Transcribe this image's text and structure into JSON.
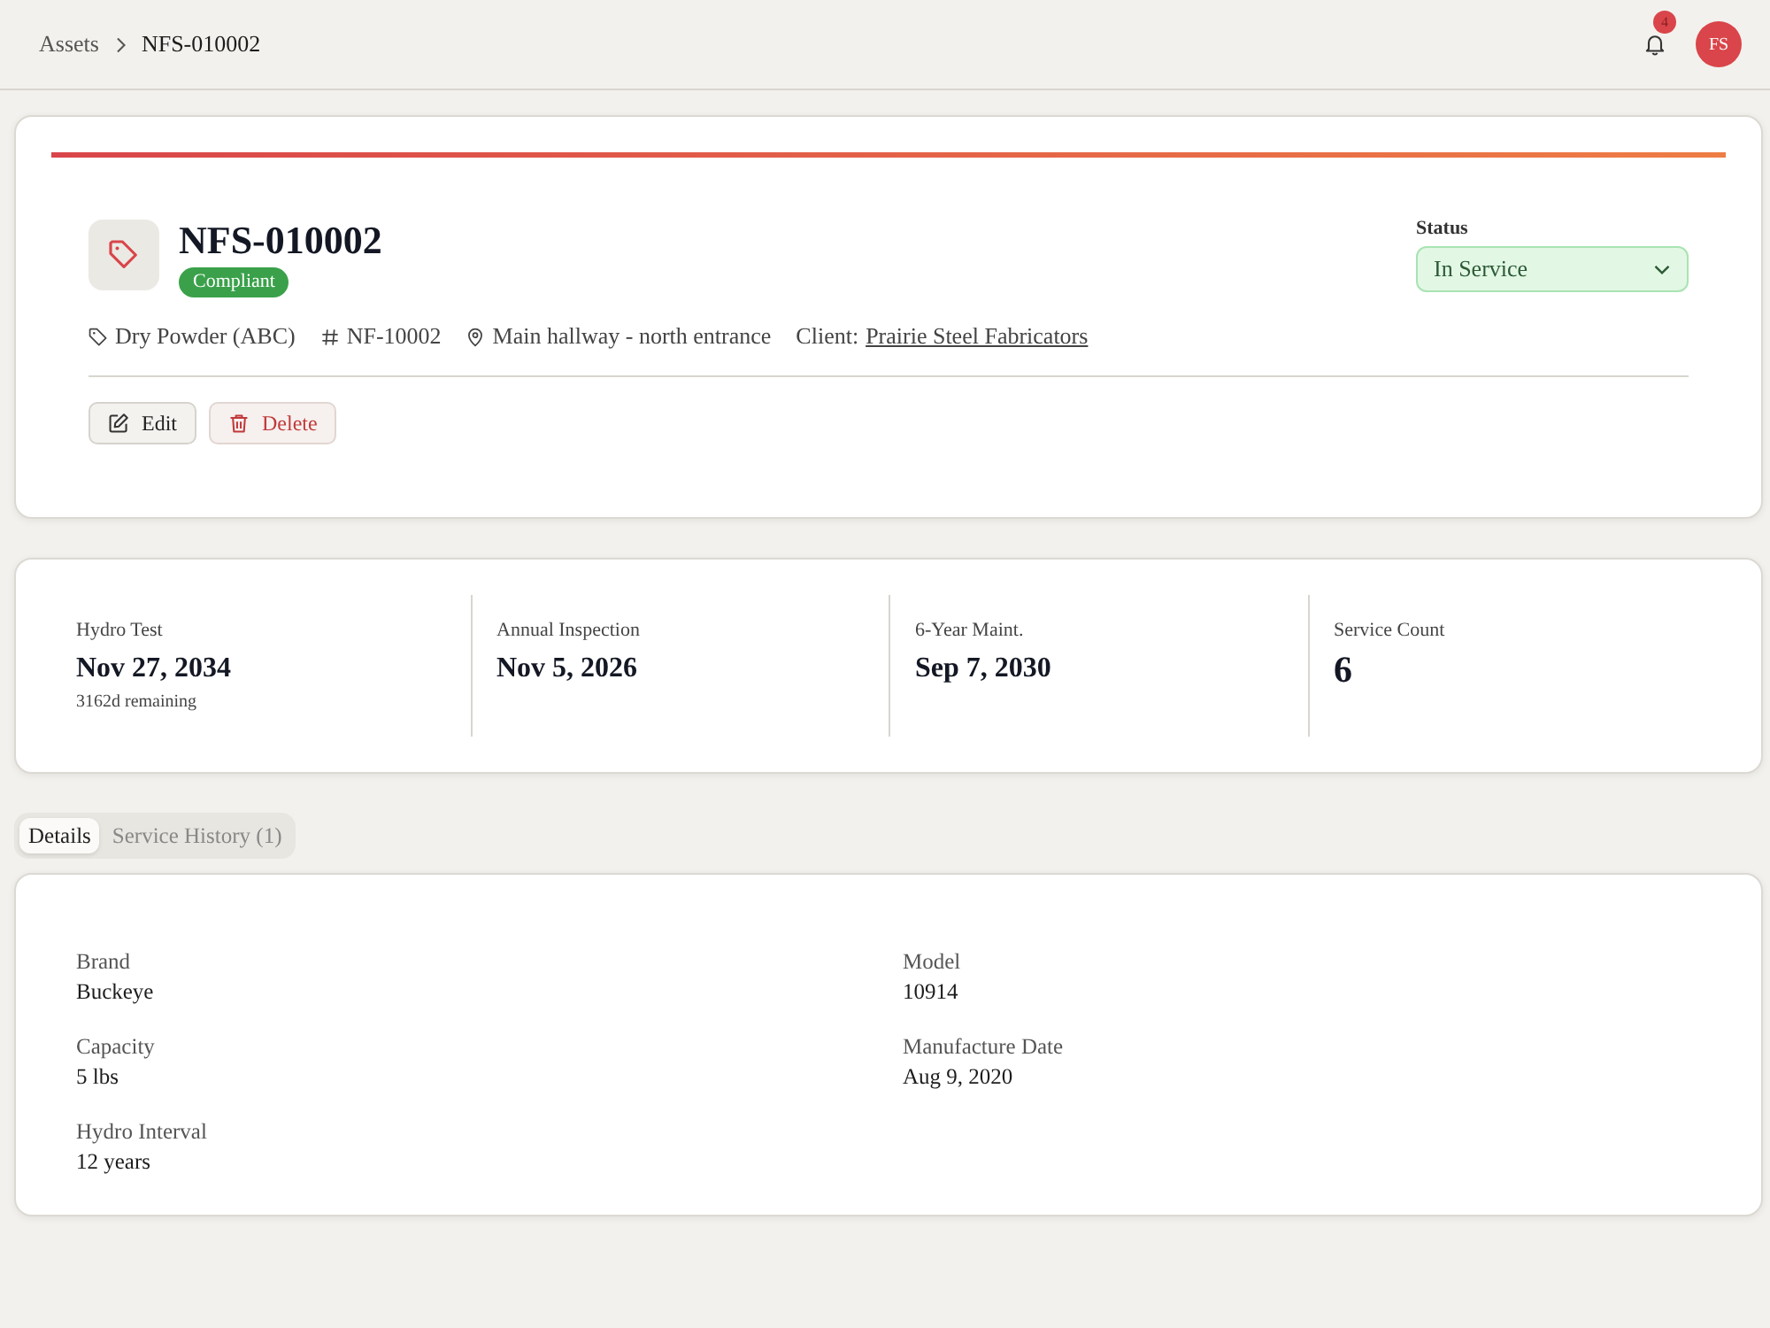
{
  "breadcrumb": [
    {
      "label": "Assets",
      "current": false
    },
    {
      "label": "NFS-010002",
      "current": true
    }
  ],
  "header": {
    "notifications": "4",
    "avatar": "FS"
  },
  "asset": {
    "title": "NFS-010002",
    "badge": "Compliant",
    "meta": [
      {
        "kind": "tag",
        "text": "Dry Powder (ABC)"
      },
      {
        "kind": "hash",
        "text": "NF-10002"
      },
      {
        "kind": "location",
        "text": "Main hallway - north entrance"
      },
      {
        "kind": "client",
        "text": "Client:",
        "link": "Prairie Steel Fabricators"
      }
    ],
    "status": {
      "label": "Status",
      "value": "In Service"
    },
    "actions": [
      {
        "kind": "edit",
        "label": "Edit"
      },
      {
        "kind": "delete",
        "label": "Delete"
      }
    ]
  },
  "stats": [
    {
      "kind": "date",
      "label": "Hydro Test",
      "value": "Nov 27, 2034",
      "note": "3162d remaining"
    },
    {
      "kind": "date",
      "label": "Annual Inspection",
      "value": "Nov 5, 2026"
    },
    {
      "kind": "date",
      "label": "6-Year Maint.",
      "value": "Sep 7, 2030"
    },
    {
      "kind": "count",
      "label": "Service Count",
      "value": "6"
    }
  ],
  "tabs": [
    {
      "label": "Details",
      "selected": true
    },
    {
      "label": "Service History (1)",
      "selected": false
    }
  ],
  "details": [
    {
      "label": "Brand",
      "value": "Buckeye"
    },
    {
      "label": "Model",
      "value": "10914"
    },
    {
      "label": "Capacity",
      "value": "5 lbs"
    },
    {
      "label": "Manufacture Date",
      "value": "Aug 9, 2020"
    },
    {
      "label": "Hydro Interval",
      "value": "12 years"
    }
  ]
}
